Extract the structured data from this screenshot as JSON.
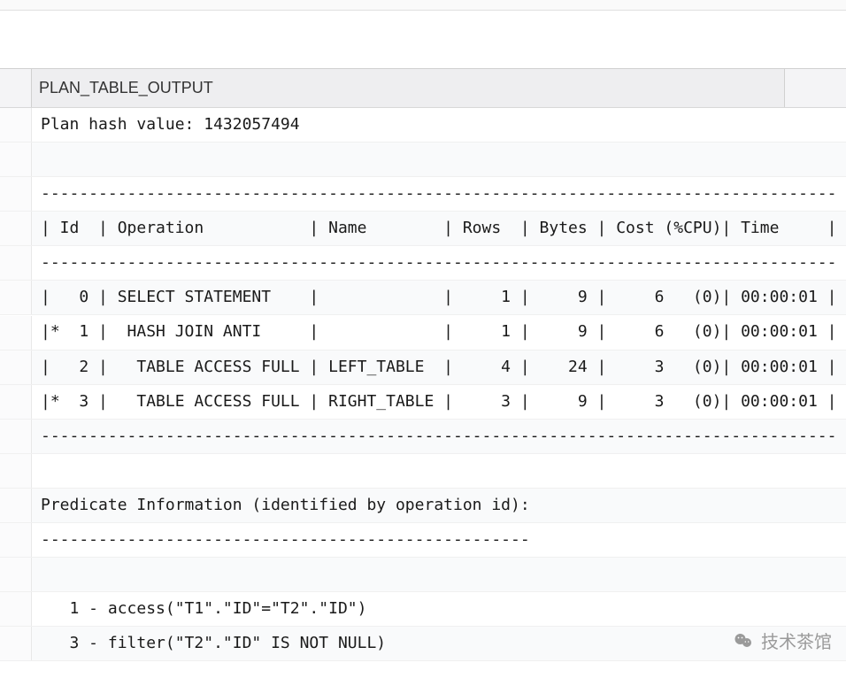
{
  "header": {
    "column_title": "PLAN_TABLE_OUTPUT"
  },
  "rows": [
    "Plan hash value: 1432057494",
    "",
    "-----------------------------------------------------------------------------------",
    "| Id  | Operation           | Name        | Rows  | Bytes | Cost (%CPU)| Time     |",
    "-----------------------------------------------------------------------------------",
    "|   0 | SELECT STATEMENT    |             |     1 |     9 |     6   (0)| 00:00:01 |",
    "|*  1 |  HASH JOIN ANTI     |             |     1 |     9 |     6   (0)| 00:00:01 |",
    "|   2 |   TABLE ACCESS FULL | LEFT_TABLE  |     4 |    24 |     3   (0)| 00:00:01 |",
    "|*  3 |   TABLE ACCESS FULL | RIGHT_TABLE |     3 |     9 |     3   (0)| 00:00:01 |",
    "-----------------------------------------------------------------------------------",
    "",
    "Predicate Information (identified by operation id):",
    "---------------------------------------------------",
    "",
    "   1 - access(\"T1\".\"ID\"=\"T2\".\"ID\")",
    "   3 - filter(\"T2\".\"ID\" IS NOT NULL)"
  ],
  "chart_data": {
    "type": "table",
    "title": "Oracle Execution Plan",
    "plan_hash_value": 1432057494,
    "columns": [
      "Id",
      "Operation",
      "Name",
      "Rows",
      "Bytes",
      "Cost (%CPU)",
      "Time"
    ],
    "rows": [
      {
        "id": 0,
        "flag": "",
        "operation": "SELECT STATEMENT",
        "name": "",
        "rows": 1,
        "bytes": 9,
        "cost": 6,
        "cpu": 0,
        "time": "00:00:01"
      },
      {
        "id": 1,
        "flag": "*",
        "operation": "HASH JOIN ANTI",
        "name": "",
        "rows": 1,
        "bytes": 9,
        "cost": 6,
        "cpu": 0,
        "time": "00:00:01"
      },
      {
        "id": 2,
        "flag": "",
        "operation": "TABLE ACCESS FULL",
        "name": "LEFT_TABLE",
        "rows": 4,
        "bytes": 24,
        "cost": 3,
        "cpu": 0,
        "time": "00:00:01"
      },
      {
        "id": 3,
        "flag": "*",
        "operation": "TABLE ACCESS FULL",
        "name": "RIGHT_TABLE",
        "rows": 3,
        "bytes": 9,
        "cost": 3,
        "cpu": 0,
        "time": "00:00:01"
      }
    ],
    "predicates": [
      {
        "id": 1,
        "type": "access",
        "expr": "\"T1\".\"ID\"=\"T2\".\"ID\""
      },
      {
        "id": 3,
        "type": "filter",
        "expr": "\"T2\".\"ID\" IS NOT NULL"
      }
    ]
  },
  "watermark": {
    "text": "技术茶馆"
  }
}
